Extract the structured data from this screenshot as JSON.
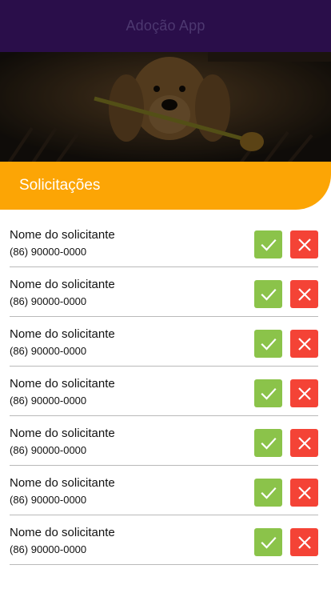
{
  "header": {
    "title": "Adoção App"
  },
  "section": {
    "title": "Solicitações"
  },
  "requests": [
    {
      "name": "Nome do solicitante",
      "phone": "(86) 90000-0000"
    },
    {
      "name": "Nome do solicitante",
      "phone": "(86) 90000-0000"
    },
    {
      "name": "Nome do solicitante",
      "phone": "(86) 90000-0000"
    },
    {
      "name": "Nome do solicitante",
      "phone": "(86) 90000-0000"
    },
    {
      "name": "Nome do solicitante",
      "phone": "(86) 90000-0000"
    },
    {
      "name": "Nome do solicitante",
      "phone": "(86) 90000-0000"
    },
    {
      "name": "Nome do solicitante",
      "phone": "(86) 90000-0000"
    }
  ],
  "icons": {
    "accept": "check-icon",
    "reject": "close-icon"
  },
  "colors": {
    "header": "#2a0e4a",
    "banner": "#fca505",
    "accept": "#8bc34a",
    "reject": "#f44336"
  }
}
